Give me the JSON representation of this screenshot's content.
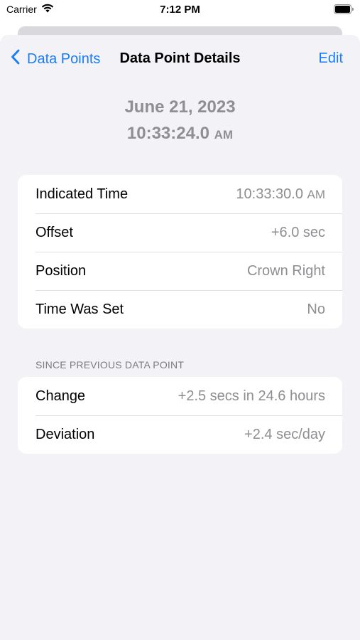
{
  "status_bar": {
    "carrier": "Carrier",
    "time": "7:12 PM"
  },
  "nav": {
    "back_label": "Data Points",
    "title": "Data Point Details",
    "edit_label": "Edit"
  },
  "header": {
    "date": "June 21, 2023",
    "time": "10:33:24.0",
    "ampm": "AM"
  },
  "details": [
    {
      "label": "Indicated Time",
      "value": "10:33:30.0",
      "suffix": "AM"
    },
    {
      "label": "Offset",
      "value": "+6.0 sec"
    },
    {
      "label": "Position",
      "value": "Crown Right"
    },
    {
      "label": "Time Was Set",
      "value": "No"
    }
  ],
  "since_section": {
    "header": "SINCE PREVIOUS DATA POINT",
    "rows": [
      {
        "label": "Change",
        "value": "+2.5 secs in 24.6 hours"
      },
      {
        "label": "Deviation",
        "value": "+2.4 sec/day"
      }
    ]
  },
  "colors": {
    "accent": "#1a7cf5",
    "background": "#f2f2f7",
    "secondary_text": "#8e8e93"
  }
}
